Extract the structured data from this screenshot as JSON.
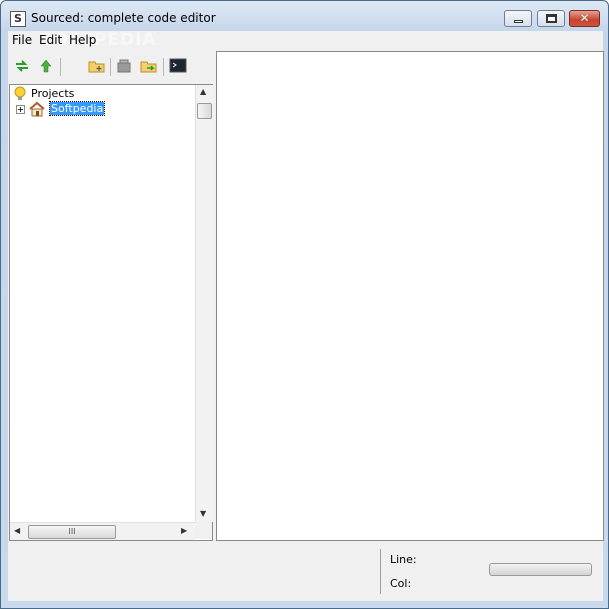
{
  "window": {
    "title": "Sourced: complete code editor",
    "app_icon_letter": "S",
    "watermark": "SOFTPEDIA"
  },
  "menubar": {
    "items": [
      "File",
      "Edit",
      "Help"
    ]
  },
  "toolbar": {
    "buttons": [
      {
        "icon": "refresh-icon"
      },
      {
        "icon": "up-arrow-icon"
      },
      {
        "icon": "new-folder-icon"
      },
      {
        "icon": "delete-icon"
      },
      {
        "icon": "move-icon"
      },
      {
        "icon": "terminal-icon"
      }
    ]
  },
  "project_tree": {
    "root_label": "Projects",
    "items": [
      {
        "label": "Softpedia",
        "icon": "home-icon",
        "selected": true,
        "expandable": true
      }
    ],
    "hscroll_grip": "III"
  },
  "status": {
    "line_label": "Line:",
    "col_label": "Col:"
  },
  "colors": {
    "selection": "#3399ff",
    "titlebar": "#c5d6ea",
    "close_button": "#c5442e"
  }
}
